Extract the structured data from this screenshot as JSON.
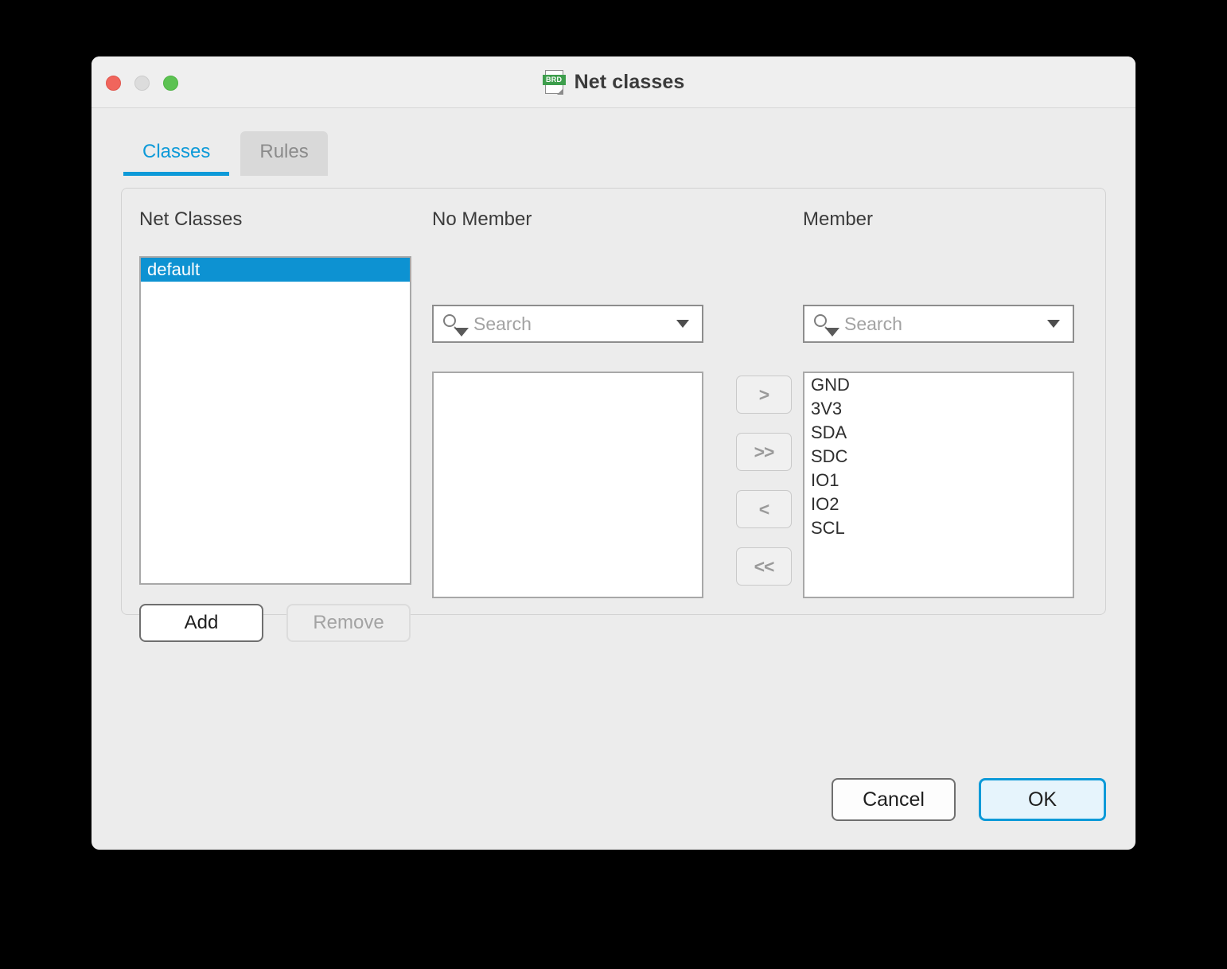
{
  "window": {
    "title": "Net classes",
    "icon": "brd-document-icon",
    "icon_badge_text": "BRD",
    "traffic_lights": {
      "close": "close-button",
      "minimize": "minimize-button",
      "zoom": "zoom-button"
    }
  },
  "tabs": [
    {
      "label": "Classes",
      "active": true
    },
    {
      "label": "Rules",
      "active": false
    }
  ],
  "panel": {
    "net_classes": {
      "title": "Net Classes",
      "items": [
        {
          "label": "default",
          "selected": true
        }
      ],
      "add_label": "Add",
      "remove_label": "Remove"
    },
    "no_member": {
      "title": "No Member",
      "search_placeholder": "Search",
      "search_value": "",
      "items": []
    },
    "member": {
      "title": "Member",
      "search_placeholder": "Search",
      "search_value": "",
      "items": [
        "GND",
        "3V3",
        "SDA",
        "SDC",
        "IO1",
        "IO2",
        "SCL"
      ]
    },
    "transfer_buttons": [
      {
        "label": ">",
        "name": "move-right"
      },
      {
        "label": ">>",
        "name": "move-all-right"
      },
      {
        "label": "<",
        "name": "move-left"
      },
      {
        "label": "<<",
        "name": "move-all-left"
      }
    ]
  },
  "footer": {
    "cancel_label": "Cancel",
    "ok_label": "OK"
  },
  "colors": {
    "accent": "#0d9ad8",
    "selection": "#0d92d2",
    "window_bg": "#ececec",
    "titlebar_bg": "#efefef",
    "badge_green": "#3d9e4c",
    "close": "#f0655c",
    "minimize": "#dcdcdc",
    "zoom": "#5cc252"
  }
}
